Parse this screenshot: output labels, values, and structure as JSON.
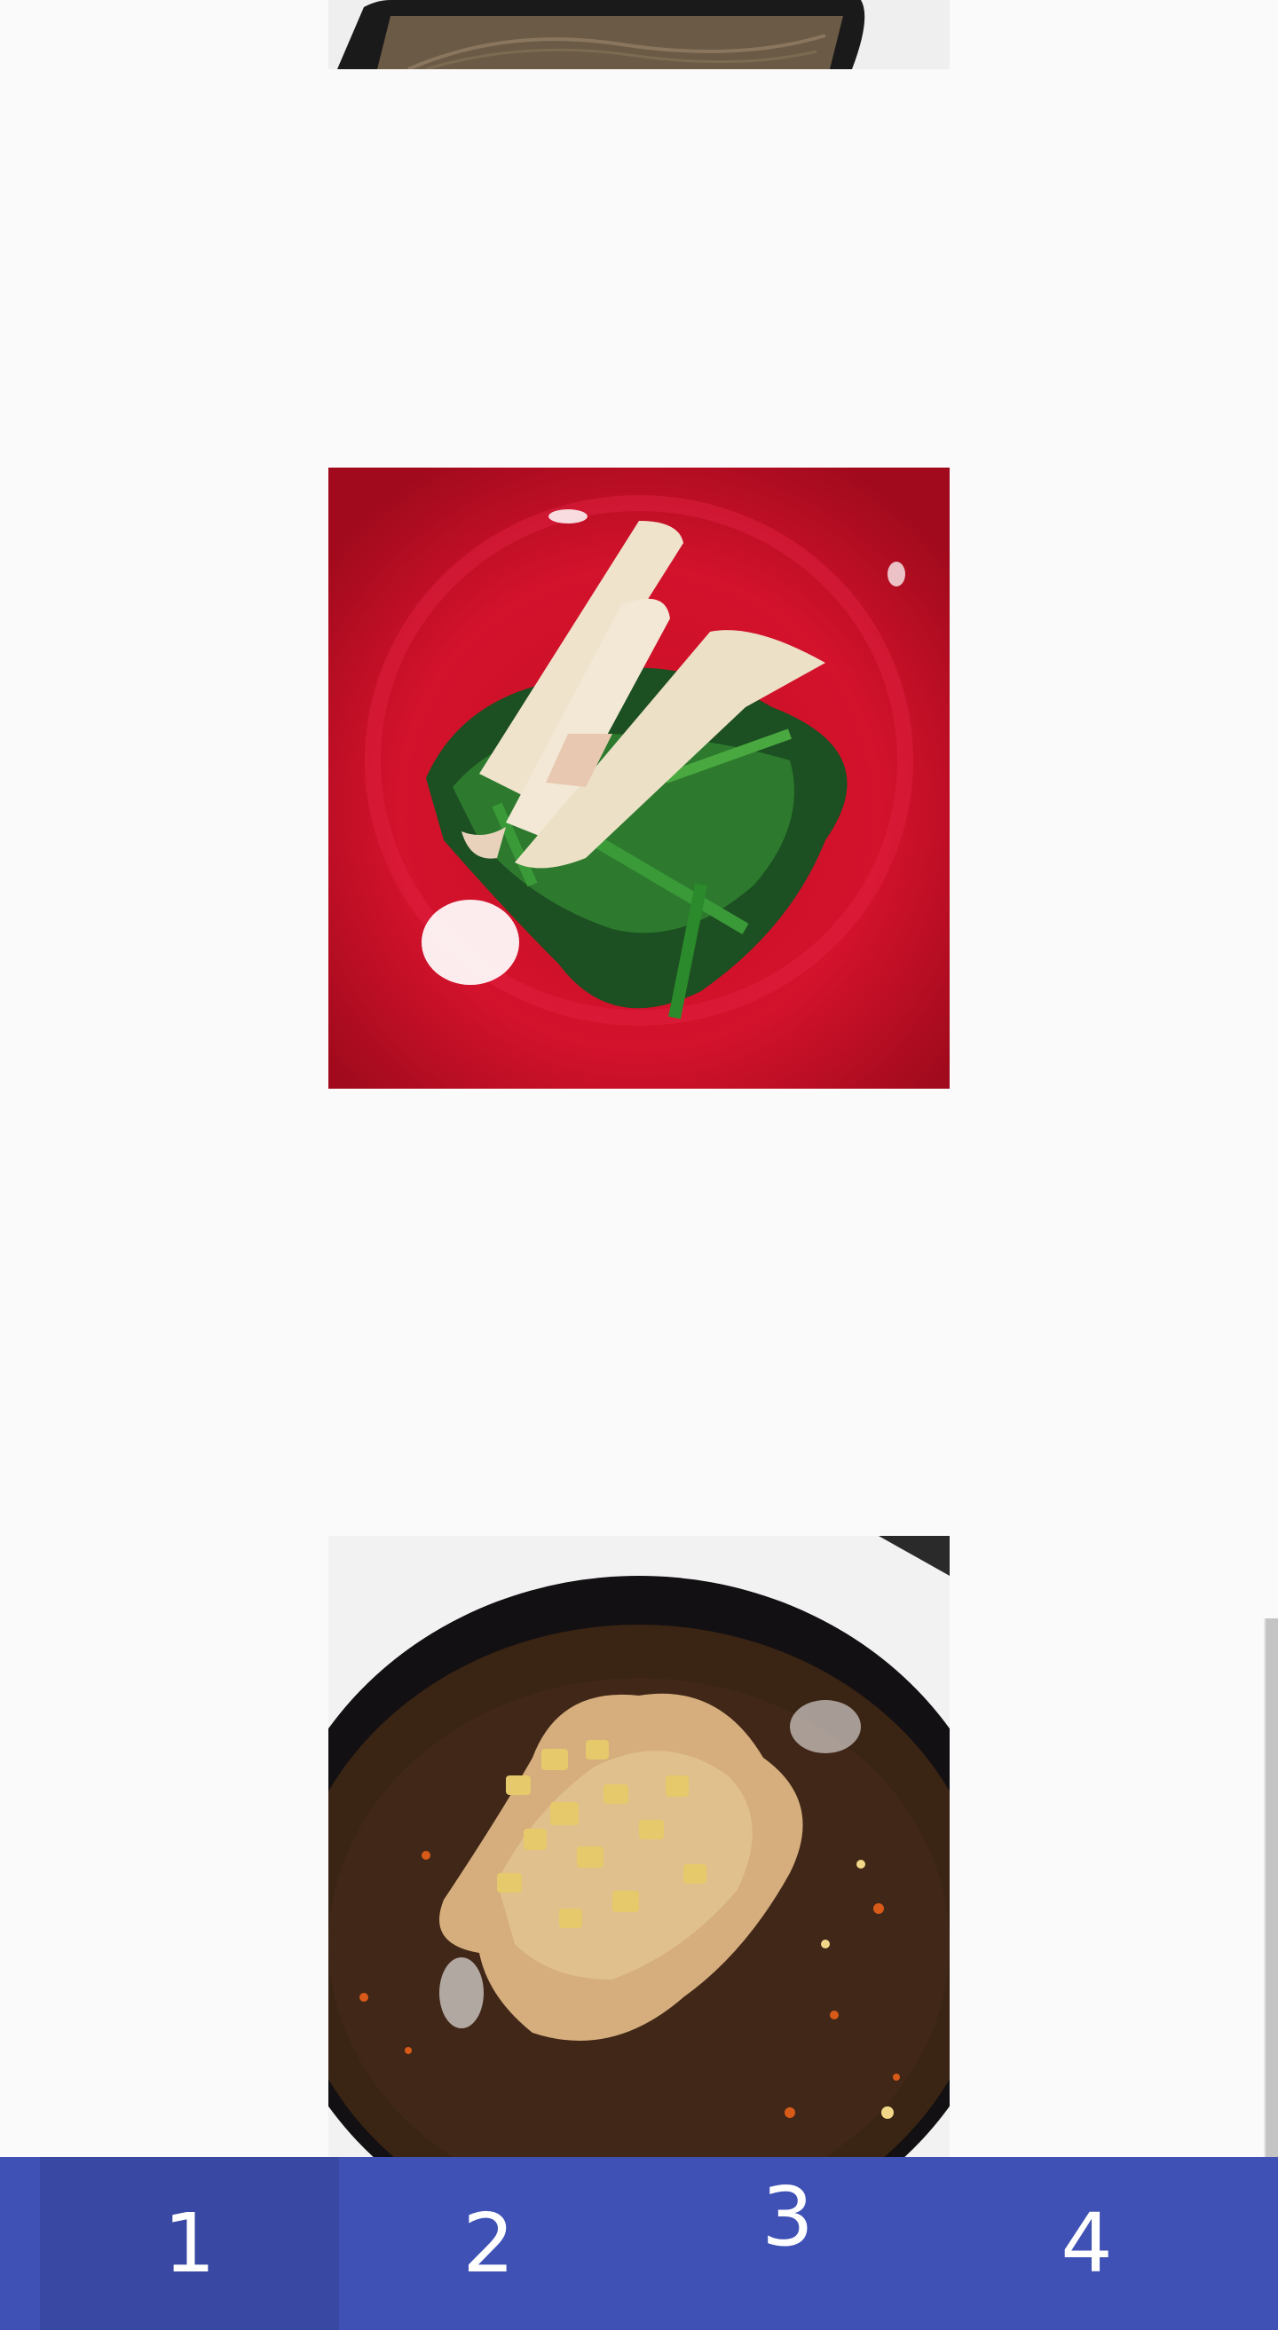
{
  "gallery": {
    "photos": [
      {
        "name": "dark-bowl-partial",
        "color_bowl": "#1b1b1b",
        "color_surface": "#ebebeb"
      },
      {
        "name": "spinach-squid-red-plate",
        "color_plate": "#d3122c",
        "color_greens": "#1f5a23",
        "color_squid": "#efe3cc"
      },
      {
        "name": "chili-oil-dish-black-bowl",
        "color_bowl": "#121012",
        "color_sauce": "#3a2414",
        "color_topping": "#e6c96a"
      }
    ]
  },
  "tabs": [
    {
      "label": "1",
      "active": true
    },
    {
      "label": "2",
      "active": false
    },
    {
      "label": "3",
      "active": false
    },
    {
      "label": "4",
      "active": false
    }
  ],
  "colors": {
    "tabbar": "#3f51b5",
    "tab_active": "#3949a3",
    "background": "#fafafa",
    "scrollbar": "#c4c4c4"
  }
}
